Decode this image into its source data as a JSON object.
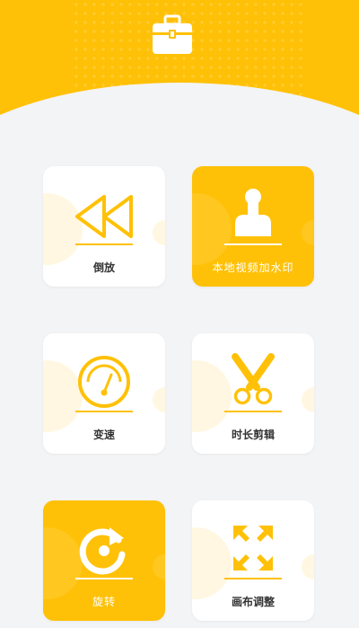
{
  "header": {
    "icon": "toolbox-icon"
  },
  "colors": {
    "accent": "#ffc107",
    "background": "#f3f4f6",
    "card": "#ffffff",
    "text": "#333333"
  },
  "tools": [
    {
      "label": "倒放",
      "icon": "rewind-icon"
    },
    {
      "label": "本地视频加水印",
      "icon": "stamp-icon"
    },
    {
      "label": "变速",
      "icon": "speedometer-icon"
    },
    {
      "label": "时长剪辑",
      "icon": "scissors-icon"
    },
    {
      "label": "旋转",
      "icon": "rotate-icon"
    },
    {
      "label": "画布调整",
      "icon": "resize-arrows-icon"
    }
  ]
}
